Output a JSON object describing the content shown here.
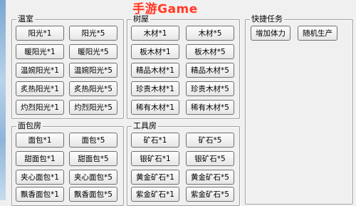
{
  "watermark": "手游Game",
  "groups": {
    "greenhouse": {
      "title": "温室",
      "buttons": [
        "阳光*1",
        "阳光*5",
        "暖阳光*1",
        "暖阳光*5",
        "温婉阳光*1",
        "温婉阳光*5",
        "炙热阳光*1",
        "炙热阳光*5",
        "灼烈阳光*1",
        "灼烈阳光*5"
      ]
    },
    "treehouse": {
      "title": "树屋",
      "buttons": [
        "木材*1",
        "木材*5",
        "板木材*1",
        "板木材*5",
        "精品木材*1",
        "精品木材*5",
        "珍贵木材*1",
        "珍贵木材*5",
        "稀有木材*1",
        "稀有木材*5"
      ]
    },
    "shortcuts": {
      "title": "快捷任务",
      "buttons": [
        "增加体力",
        "随机生产"
      ]
    },
    "bakery": {
      "title": "面包房",
      "buttons": [
        "面包*1",
        "面包*5",
        "甜面包*1",
        "甜面包*5",
        "夹心面包*1",
        "夹心面包*5",
        "飘香面包*1",
        "飘香面包*5"
      ]
    },
    "workshop": {
      "title": "工具房",
      "buttons": [
        "矿石*1",
        "矿石*5",
        "银矿石*1",
        "银矿石*5",
        "黄金矿石*1",
        "黄金矿石*5",
        "紫金矿石*1",
        "紫金矿石*5"
      ]
    }
  }
}
